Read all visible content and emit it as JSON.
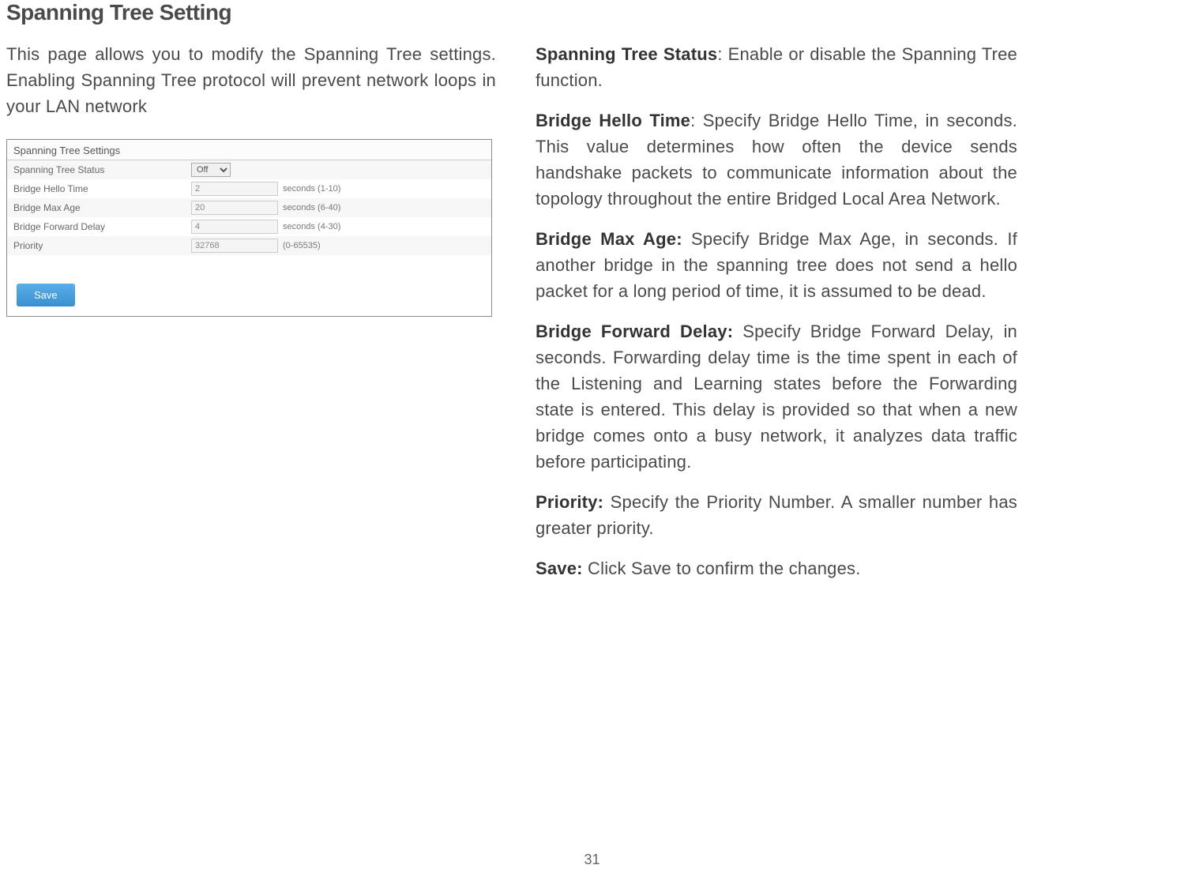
{
  "page": {
    "title": "Spanning Tree Setting",
    "intro": "This page allows you to modify the Spanning Tree settings. Enabling Spanning Tree protocol will prevent network loops in your LAN network",
    "page_number": "31"
  },
  "panel": {
    "header": "Spanning Tree Settings",
    "rows": {
      "status": {
        "label": "Spanning Tree Status",
        "value": "Off"
      },
      "hello": {
        "label": "Bridge Hello Time",
        "value": "2",
        "hint": "seconds (1-10)"
      },
      "maxage": {
        "label": "Bridge Max Age",
        "value": "20",
        "hint": "seconds (6-40)"
      },
      "forward": {
        "label": "Bridge Forward Delay",
        "value": "4",
        "hint": "seconds (4-30)"
      },
      "priority": {
        "label": "Priority",
        "value": "32768",
        "hint": "(0-65535)"
      }
    },
    "save_label": "Save"
  },
  "definitions": {
    "status": {
      "term": "Spanning Tree Status",
      "text": ": Enable or disable the Spanning Tree function."
    },
    "hello": {
      "term": "Bridge Hello Time",
      "text": ": Specify Bridge Hello Time, in seconds. This value determines how often the device sends handshake packets to communicate information about the topology throughout the entire Bridged Local Area Network."
    },
    "maxage": {
      "term": "Bridge Max Age:",
      "text": " Specify Bridge Max Age, in seconds. If another bridge in the spanning tree does not send a hello packet for a long period of time, it is assumed to be dead."
    },
    "forward": {
      "term": "Bridge Forward Delay:",
      "text": " Specify Bridge Forward Delay, in seconds. Forwarding delay time is the time spent in each of the Listening and Learning states before the Forwarding state is entered. This delay is provided so that when a new bridge comes onto a busy network, it analyzes data traffic before participating."
    },
    "priority": {
      "term": "Priority:",
      "text": " Specify the Priority Number. A smaller number has greater priority."
    },
    "save": {
      "term": "Save:",
      "text": " Click Save to confirm the changes."
    }
  }
}
